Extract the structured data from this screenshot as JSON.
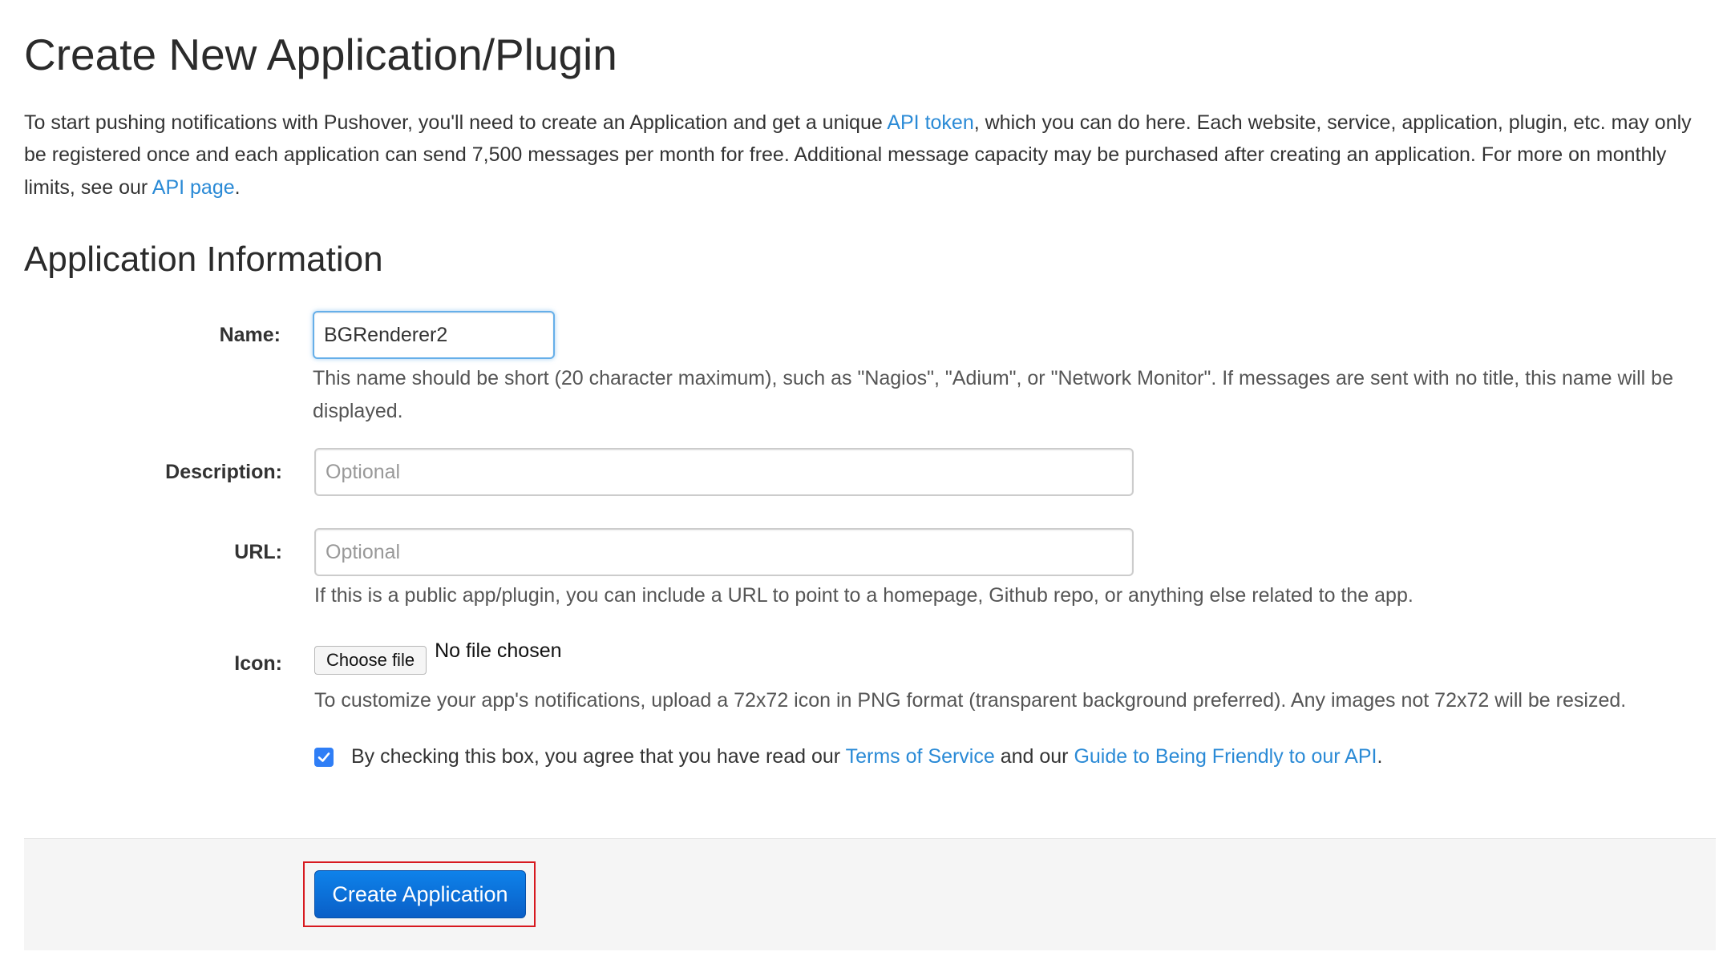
{
  "page": {
    "title": "Create New Application/Plugin",
    "intro": {
      "part1": "To start pushing notifications with Pushover, you'll need to create an Application and get a unique ",
      "api_token_link": "API token",
      "part2": ", which you can do here. Each website, service, application, plugin, etc. may only be registered once and each application can send 7,500 messages per month for free. Additional message capacity may be purchased after creating an application. For more on monthly limits, see our ",
      "api_page_link": "API page",
      "part3": "."
    },
    "section_title": "Application Information"
  },
  "form": {
    "name": {
      "label": "Name:",
      "value": "BGRenderer2",
      "help": "This name should be short (20 character maximum), such as \"Nagios\", \"Adium\", or \"Network Monitor\". If messages are sent with no title, this name will be displayed."
    },
    "description": {
      "label": "Description:",
      "value": "",
      "placeholder": "Optional"
    },
    "url": {
      "label": "URL:",
      "value": "",
      "placeholder": "Optional",
      "help": "If this is a public app/plugin, you can include a URL to point to a homepage, Github repo, or anything else related to the app."
    },
    "icon": {
      "label": "Icon:",
      "button_label": "Choose file",
      "file_status": "No file chosen",
      "help": "To customize your app's notifications, upload a 72x72 icon in PNG format (transparent background preferred). Any images not 72x72 will be resized."
    },
    "agreement": {
      "checked": true,
      "text1": "By checking this box, you agree that you have read our ",
      "tos_link": "Terms of Service",
      "text2": " and our ",
      "guide_link": "Guide to Being Friendly to our API",
      "text3": "."
    },
    "submit_label": "Create Application"
  },
  "colors": {
    "link": "#2a8ad6",
    "primary_button": "#0a6fd9",
    "checkbox": "#2f7ef6",
    "highlight_border": "#d7191f",
    "actions_background": "#f5f5f5"
  },
  "icons": {
    "checkbox": "checkmark-icon"
  }
}
